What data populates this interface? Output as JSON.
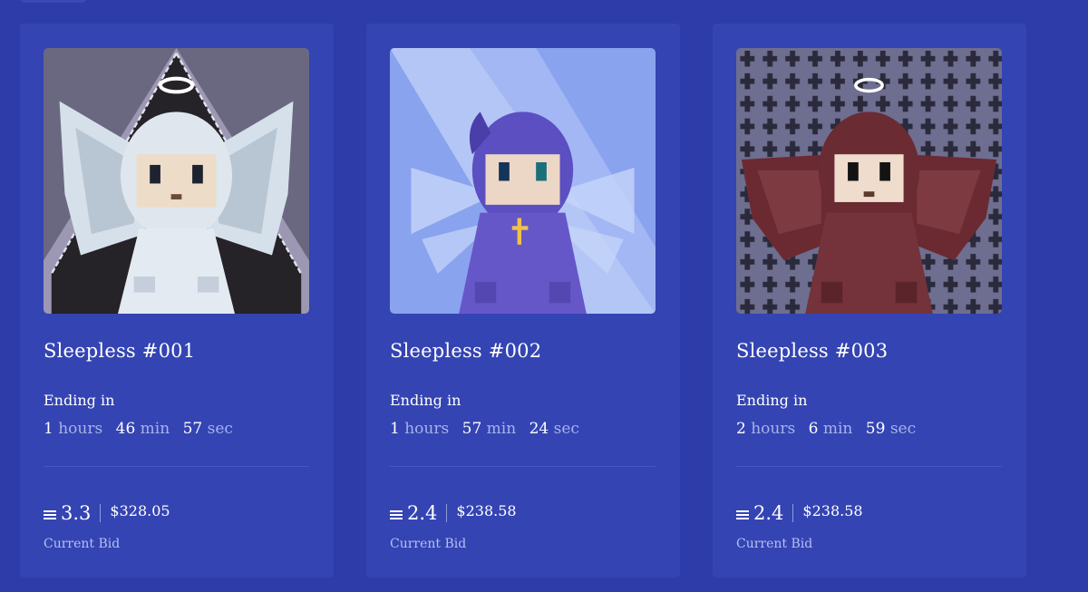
{
  "cards": [
    {
      "title": "Sleepless #001",
      "ending_label": "Ending in",
      "hours": "1",
      "hours_unit": "hours",
      "minutes": "46",
      "minutes_unit": "min",
      "seconds": "57",
      "seconds_unit": "sec",
      "bid_eth": "3.3",
      "bid_usd": "$328.05",
      "bid_label": "Current Bid",
      "art": "angel-white-wings-pixel-art"
    },
    {
      "title": "Sleepless #002",
      "ending_label": "Ending in",
      "hours": "1",
      "hours_unit": "hours",
      "minutes": "57",
      "minutes_unit": "min",
      "seconds": "24",
      "seconds_unit": "sec",
      "bid_eth": "2.4",
      "bid_usd": "$238.58",
      "bid_label": "Current Bid",
      "art": "purple-hood-cross-pixel-art"
    },
    {
      "title": "Sleepless #003",
      "ending_label": "Ending in",
      "hours": "2",
      "hours_unit": "hours",
      "minutes": "6",
      "minutes_unit": "min",
      "seconds": "59",
      "seconds_unit": "sec",
      "bid_eth": "2.4",
      "bid_usd": "$238.58",
      "bid_label": "Current Bid",
      "art": "red-demon-wings-pixel-art"
    }
  ],
  "colors": {
    "background": "#2d3ca8",
    "card": "#3444b3",
    "muted_unit": "#a7b3ea"
  },
  "icons": {
    "currency": "eth-icon"
  }
}
